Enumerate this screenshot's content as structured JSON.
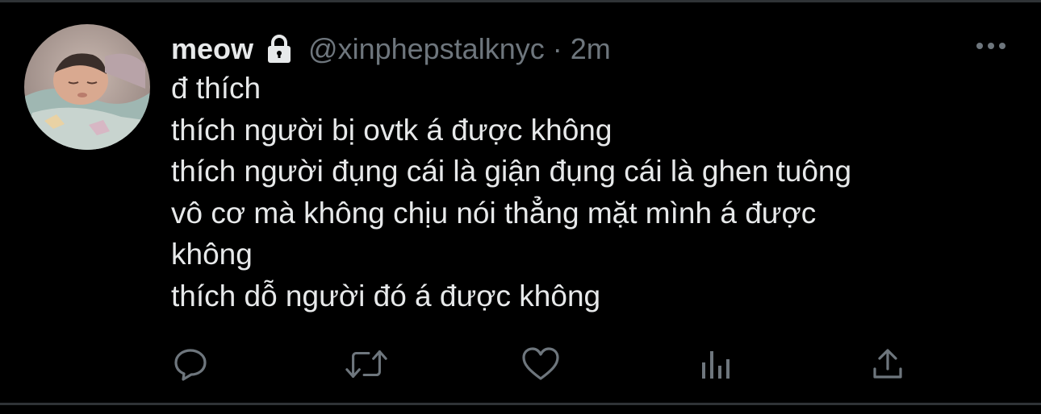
{
  "tweet": {
    "display_name": "meow",
    "handle": "@xinphepstalknyc",
    "separator": "·",
    "time": "2m",
    "lines": [
      "đ thích",
      "thích người bị ovtk á được không",
      "thích người đụng cái là giận đụng cái là ghen tuông",
      "vô cơ mà không chịu nói thẳng mặt mình á được",
      "không",
      "thích dỗ người đó á được không"
    ],
    "protected_icon": "lock-icon",
    "avatar": "avatar-photo"
  },
  "actions": [
    {
      "name": "reply",
      "icon": "reply-icon"
    },
    {
      "name": "retweet",
      "icon": "retweet-icon"
    },
    {
      "name": "like",
      "icon": "heart-icon"
    },
    {
      "name": "analytics",
      "icon": "analytics-icon"
    },
    {
      "name": "share",
      "icon": "share-icon"
    }
  ],
  "colors": {
    "background": "#000000",
    "text": "#e7e9ea",
    "secondary": "#6e767d",
    "divider": "#2f3336"
  }
}
